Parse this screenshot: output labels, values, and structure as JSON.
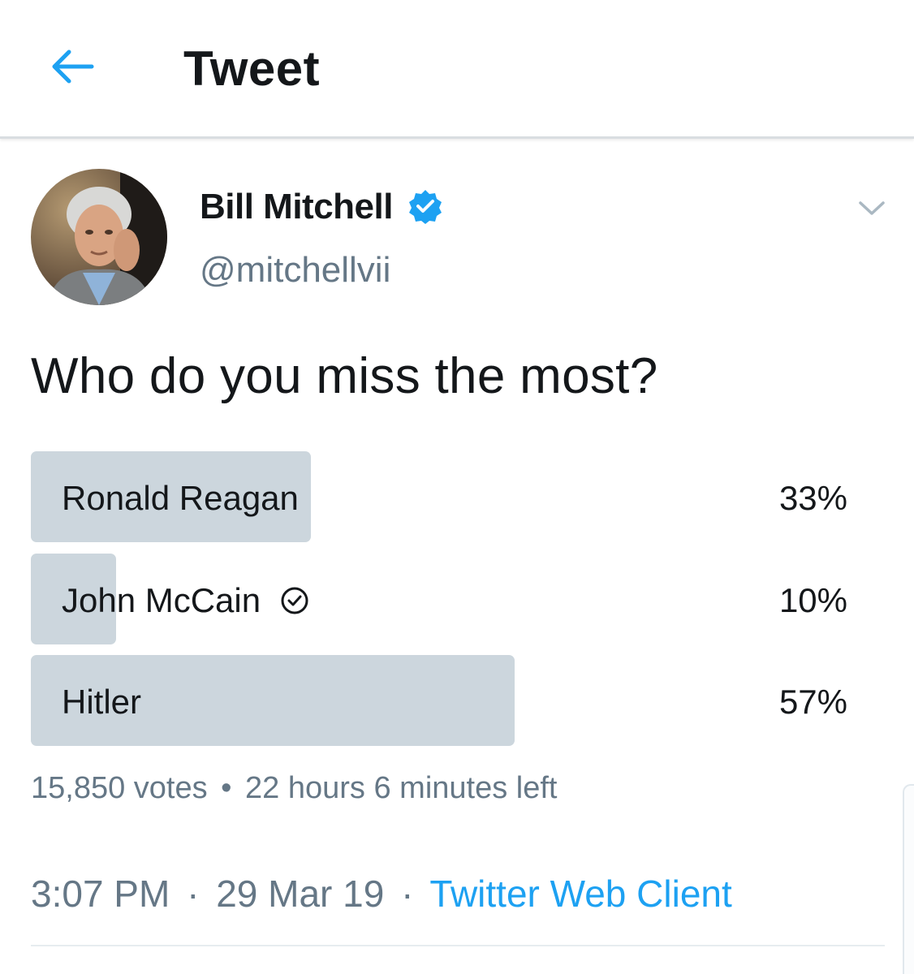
{
  "header": {
    "title": "Tweet",
    "back_icon": "arrow-left-icon"
  },
  "author": {
    "name": "Bill Mitchell",
    "handle": "@mitchellvii",
    "verified": true
  },
  "tweet": {
    "text": "Who do you miss the most?"
  },
  "poll": {
    "options": [
      {
        "label": "Ronald Reagan",
        "percent_label": "33%",
        "percent": 33,
        "voted": false
      },
      {
        "label": "John McCain",
        "percent_label": "10%",
        "percent": 10,
        "voted": true
      },
      {
        "label": "Hitler",
        "percent_label": "57%",
        "percent": 57,
        "voted": false
      }
    ],
    "votes": "15,850 votes",
    "time_left": "22 hours 6 minutes left",
    "separator": "•"
  },
  "meta": {
    "time": "3:07 PM",
    "date": "29 Mar 19",
    "separator": "·",
    "source": "Twitter Web Client"
  },
  "colors": {
    "accent": "#1da1f2",
    "poll_bar": "#ccd6dd",
    "secondary_text": "#657786"
  }
}
